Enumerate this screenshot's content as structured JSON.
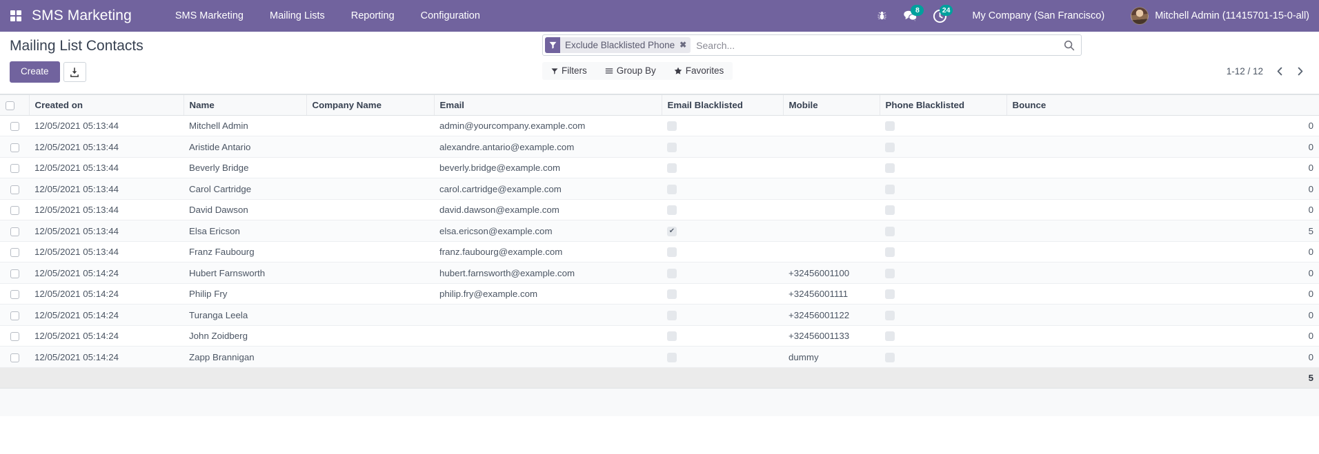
{
  "navbar": {
    "apps_icon": "apps-grid-icon",
    "brand": "SMS Marketing",
    "menu": [
      {
        "label": "SMS Marketing"
      },
      {
        "label": "Mailing Lists"
      },
      {
        "label": "Reporting"
      },
      {
        "label": "Configuration"
      }
    ],
    "systray": {
      "bug_icon": "bug-icon",
      "messages_icon": "messages-icon",
      "messages_count": "8",
      "activities_icon": "activity-clock-icon",
      "activities_count": "24"
    },
    "company": "My Company (San Francisco)",
    "user": "Mitchell Admin (11415701-15-0-all)",
    "accent": "#71639e",
    "badge_color": "#00a09d"
  },
  "control_panel": {
    "title": "Mailing List Contacts",
    "create_label": "Create",
    "import_icon": "import-download-icon",
    "search": {
      "facet_icon": "filter-funnel-icon",
      "facet_label": "Exclude Blacklisted Phone",
      "facet_remove_icon": "close-x-icon",
      "placeholder": "Search...",
      "value": "",
      "search_icon": "search-icon"
    },
    "filters_label": "Filters",
    "filters_icon": "filter-caret-icon",
    "groupby_label": "Group By",
    "groupby_icon": "hamburger-lines-icon",
    "favorites_label": "Favorites",
    "favorites_icon": "star-icon",
    "pager_value": "1-12 / 12",
    "pager_prev_icon": "chevron-left-icon",
    "pager_next_icon": "chevron-right-icon"
  },
  "table": {
    "columns": [
      "Created on",
      "Name",
      "Company Name",
      "Email",
      "Email Blacklisted",
      "Mobile",
      "Phone Blacklisted",
      "Bounce"
    ],
    "rows": [
      {
        "created_on": "12/05/2021 05:13:44",
        "name": "Mitchell Admin",
        "company": "",
        "email": "admin@yourcompany.example.com",
        "email_blacklisted": false,
        "mobile": "",
        "phone_blacklisted": false,
        "bounce": "0"
      },
      {
        "created_on": "12/05/2021 05:13:44",
        "name": "Aristide Antario",
        "company": "",
        "email": "alexandre.antario@example.com",
        "email_blacklisted": false,
        "mobile": "",
        "phone_blacklisted": false,
        "bounce": "0"
      },
      {
        "created_on": "12/05/2021 05:13:44",
        "name": "Beverly Bridge",
        "company": "",
        "email": "beverly.bridge@example.com",
        "email_blacklisted": false,
        "mobile": "",
        "phone_blacklisted": false,
        "bounce": "0"
      },
      {
        "created_on": "12/05/2021 05:13:44",
        "name": "Carol Cartridge",
        "company": "",
        "email": "carol.cartridge@example.com",
        "email_blacklisted": false,
        "mobile": "",
        "phone_blacklisted": false,
        "bounce": "0"
      },
      {
        "created_on": "12/05/2021 05:13:44",
        "name": "David Dawson",
        "company": "",
        "email": "david.dawson@example.com",
        "email_blacklisted": false,
        "mobile": "",
        "phone_blacklisted": false,
        "bounce": "0"
      },
      {
        "created_on": "12/05/2021 05:13:44",
        "name": "Elsa Ericson",
        "company": "",
        "email": "elsa.ericson@example.com",
        "email_blacklisted": true,
        "mobile": "",
        "phone_blacklisted": false,
        "bounce": "5"
      },
      {
        "created_on": "12/05/2021 05:13:44",
        "name": "Franz Faubourg",
        "company": "",
        "email": "franz.faubourg@example.com",
        "email_blacklisted": false,
        "mobile": "",
        "phone_blacklisted": false,
        "bounce": "0"
      },
      {
        "created_on": "12/05/2021 05:14:24",
        "name": "Hubert Farnsworth",
        "company": "",
        "email": "hubert.farnsworth@example.com",
        "email_blacklisted": false,
        "mobile": "+32456001100",
        "phone_blacklisted": false,
        "bounce": "0"
      },
      {
        "created_on": "12/05/2021 05:14:24",
        "name": "Philip Fry",
        "company": "",
        "email": "philip.fry@example.com",
        "email_blacklisted": false,
        "mobile": "+32456001111",
        "phone_blacklisted": false,
        "bounce": "0"
      },
      {
        "created_on": "12/05/2021 05:14:24",
        "name": "Turanga Leela",
        "company": "",
        "email": "",
        "email_blacklisted": false,
        "mobile": "+32456001122",
        "phone_blacklisted": false,
        "bounce": "0"
      },
      {
        "created_on": "12/05/2021 05:14:24",
        "name": "John Zoidberg",
        "company": "",
        "email": "",
        "email_blacklisted": false,
        "mobile": "+32456001133",
        "phone_blacklisted": false,
        "bounce": "0"
      },
      {
        "created_on": "12/05/2021 05:14:24",
        "name": "Zapp Brannigan",
        "company": "",
        "email": "",
        "email_blacklisted": false,
        "mobile": "dummy",
        "phone_blacklisted": false,
        "bounce": "0"
      }
    ],
    "footer_bounce_total": "5"
  }
}
